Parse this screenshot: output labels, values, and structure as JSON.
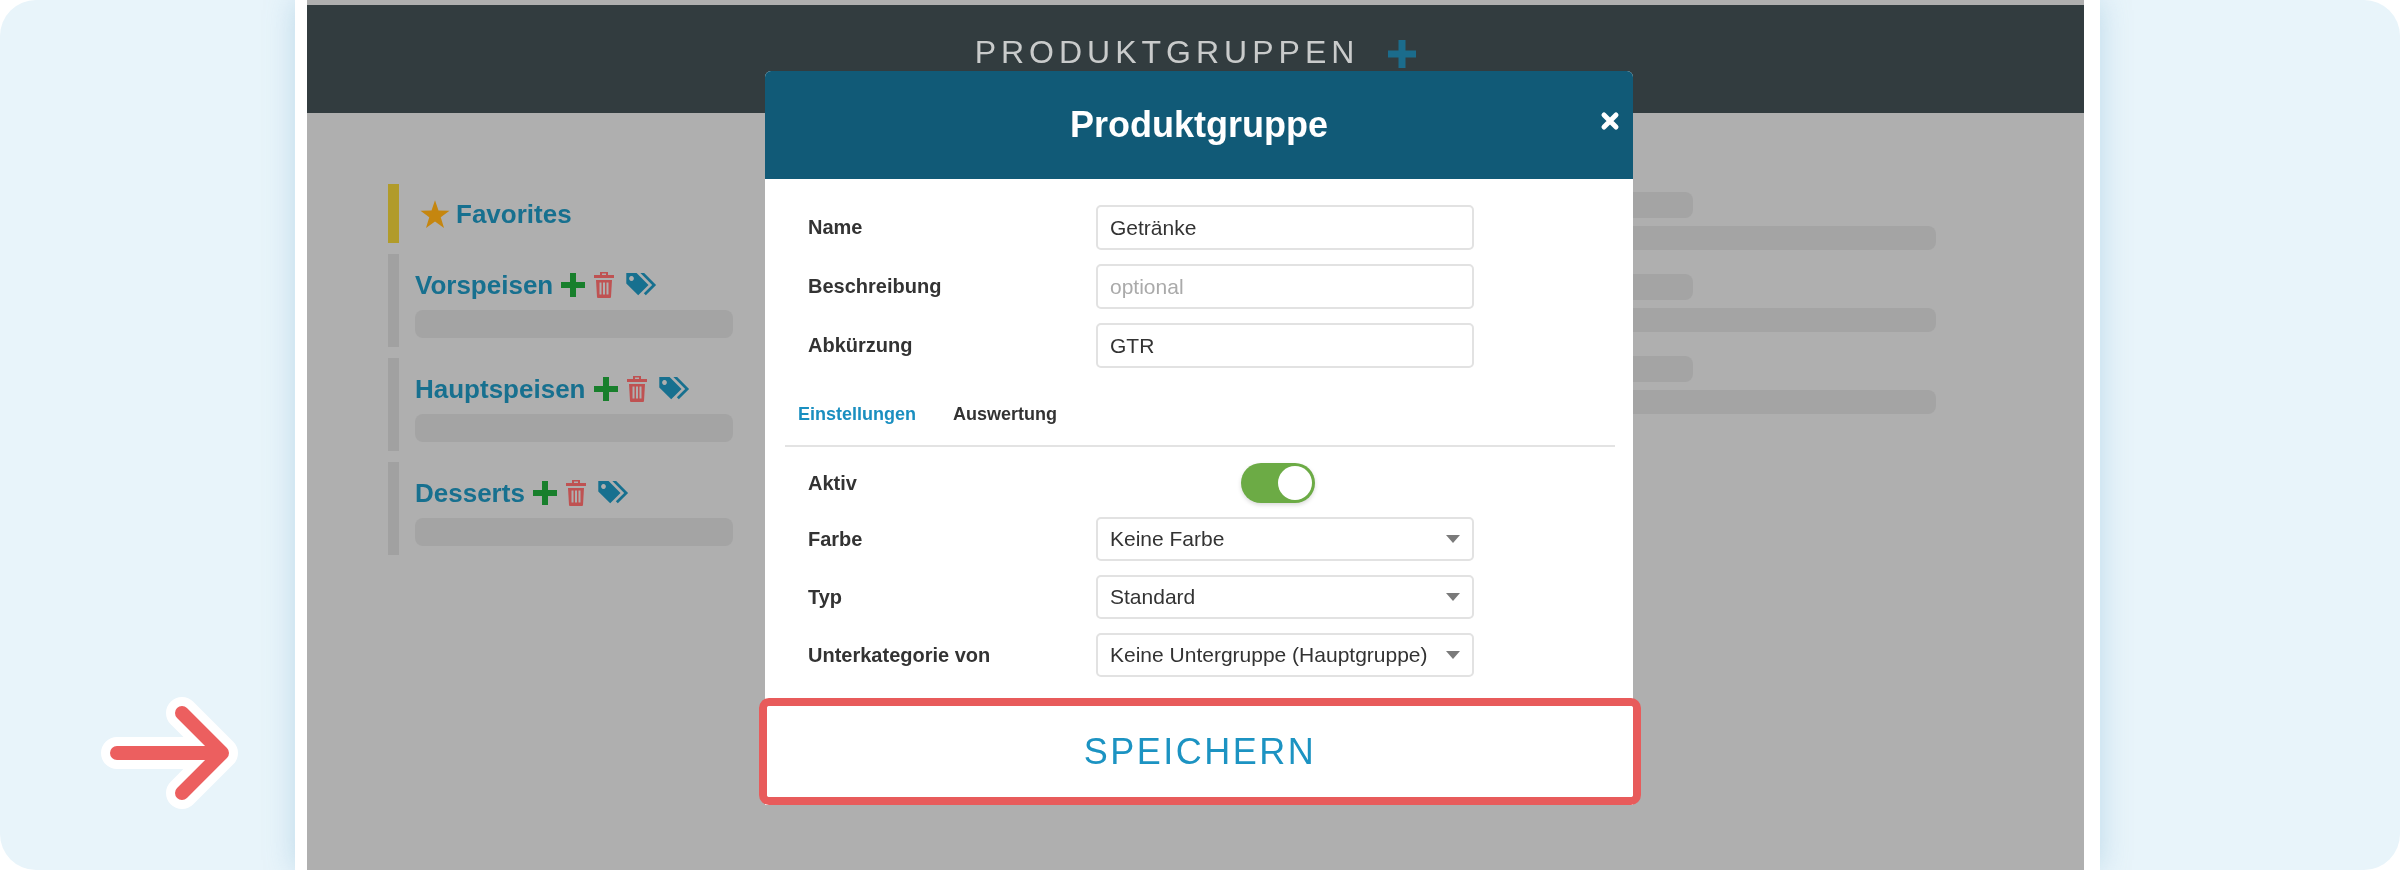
{
  "page_header": {
    "title": "PRODUKTGRUPPEN"
  },
  "sidebar": {
    "items": [
      {
        "kind": "favorites",
        "label": "Favorites"
      },
      {
        "kind": "group",
        "label": "Vorspeisen"
      },
      {
        "kind": "group",
        "label": "Hauptspeisen"
      },
      {
        "kind": "group",
        "label": "Desserts"
      }
    ]
  },
  "modal": {
    "title": "Produktgruppe",
    "fields": [
      {
        "label": "Name",
        "value": "Getränke"
      },
      {
        "label": "Beschreibung",
        "placeholder": "optional"
      },
      {
        "label": "Abkürzung",
        "value": "GTR"
      }
    ],
    "tabs": [
      {
        "label": "Einstellungen",
        "selected": true
      },
      {
        "label": "Auswertung",
        "selected": false
      }
    ],
    "settings": [
      {
        "kind": "toggle",
        "label": "Aktiv",
        "on": true
      },
      {
        "kind": "select",
        "label": "Farbe",
        "value": "Keine Farbe"
      },
      {
        "kind": "select",
        "label": "Typ",
        "value": "Standard"
      },
      {
        "kind": "select",
        "label": "Unterkategorie von",
        "value": "Keine Untergruppe (Hauptgruppe)"
      }
    ],
    "save_button": {
      "label": "SPEICHERN",
      "highlighted": true
    }
  }
}
